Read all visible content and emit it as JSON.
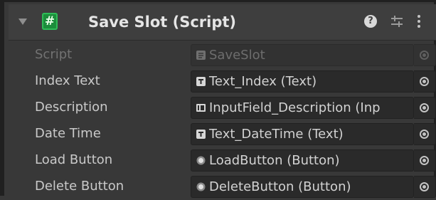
{
  "component": {
    "title": "Save Slot (Script)",
    "script_icon_glyph": "#",
    "help_glyph": "?",
    "icons": [
      "foldout-arrow-icon",
      "script-icon",
      "help-icon",
      "presets-icon",
      "context-menu-icon"
    ]
  },
  "fields": [
    {
      "label": "Script",
      "value": "SaveSlot",
      "icon": "script-asset-icon",
      "disabled": true
    },
    {
      "label": "Index Text",
      "value": "Text_Index (Text)",
      "icon": "text-component-icon",
      "disabled": false
    },
    {
      "label": "Description",
      "value": "InputField_Description (Inp",
      "icon": "input-field-icon",
      "disabled": false
    },
    {
      "label": "Date Time",
      "value": "Text_DateTime (Text)",
      "icon": "text-component-icon",
      "disabled": false
    },
    {
      "label": "Load Button",
      "value": "LoadButton (Button)",
      "icon": "button-component-icon",
      "disabled": false
    },
    {
      "label": "Delete Button",
      "value": "DeleteButton (Button)",
      "icon": "button-component-icon",
      "disabled": false
    }
  ],
  "colors": {
    "panel_bg": "#383838",
    "header_bg": "#3e3e3e",
    "field_bg": "#2a2a2a",
    "label_text": "#c9c9c9",
    "disabled_text": "#727272",
    "script_icon_green": "#1b8d3b"
  }
}
